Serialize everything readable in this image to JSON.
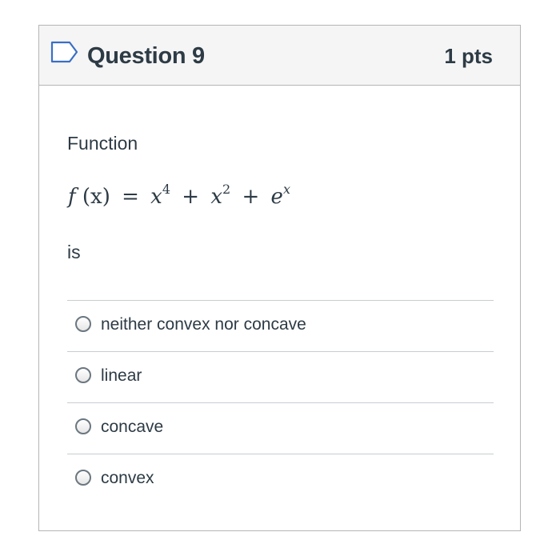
{
  "question": {
    "title": "Question 9",
    "points": "1 pts",
    "text": "Function",
    "formula": {
      "f": "f",
      "arg": "(x)",
      "eq": "=",
      "t1_base": "x",
      "t1_exp": "4",
      "plus1": "+",
      "t2_base": "x",
      "t2_exp": "2",
      "plus2": "+",
      "t3_base": "e",
      "t3_exp": "x"
    },
    "suffix": "is",
    "answers": [
      {
        "label": "neither convex nor concave",
        "selected": false
      },
      {
        "label": "linear",
        "selected": false
      },
      {
        "label": "concave",
        "selected": false
      },
      {
        "label": "convex",
        "selected": false
      }
    ]
  },
  "icons": {
    "flag": "bookmark-flag-icon",
    "radio": "radio-button-icon"
  },
  "colors": {
    "text": "#2d3b45",
    "header_bg": "#f5f5f5",
    "border": "#b5b5b5",
    "flag": "#3a6fc4"
  }
}
